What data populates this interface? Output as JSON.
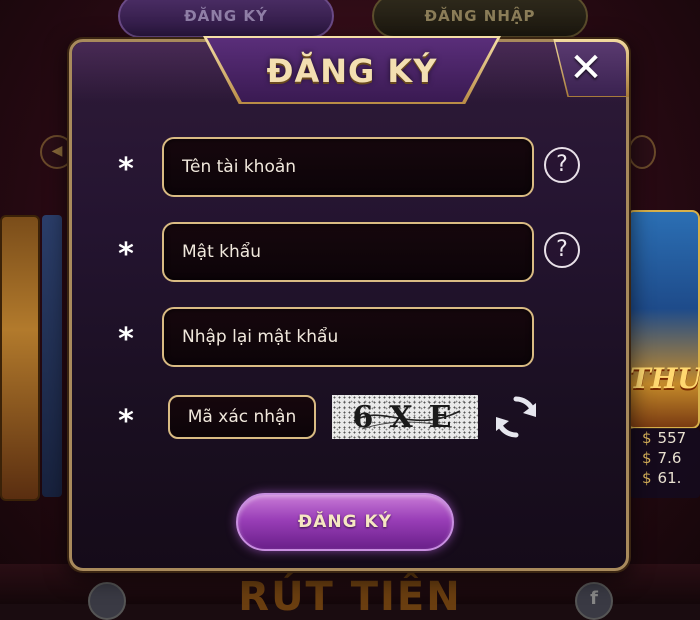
{
  "background": {
    "top_tabs": [
      {
        "label": "ĐĂNG KÝ"
      },
      {
        "label": "ĐĂNG NHẬP"
      }
    ],
    "right_card_title": "THU",
    "jackpots": [
      "557",
      "7.6",
      "61."
    ],
    "jackpot_symbol": "$",
    "bottom_text": "RÚT TIỀN",
    "bottom_right_icon": "f"
  },
  "modal": {
    "title": "ĐĂNG KÝ",
    "close_glyph": "✕",
    "required_mark": "*",
    "fields": [
      {
        "placeholder": "Tên tài khoản",
        "value": "",
        "help": "?"
      },
      {
        "placeholder": "Mật khẩu",
        "value": "",
        "help": "?"
      },
      {
        "placeholder": "Nhập lại mật khẩu",
        "value": ""
      }
    ],
    "captcha": {
      "placeholder": "Mã xác nhận",
      "value": "",
      "image_text": "6XE"
    },
    "submit_label": "ĐĂNG KÝ"
  },
  "icons": {
    "close": "close-icon",
    "help": "help-icon",
    "refresh": "refresh-icon"
  },
  "colors": {
    "accent_gold": "#d9bb83",
    "button_purple": "#9a3fb8",
    "modal_bg": "#241430"
  }
}
